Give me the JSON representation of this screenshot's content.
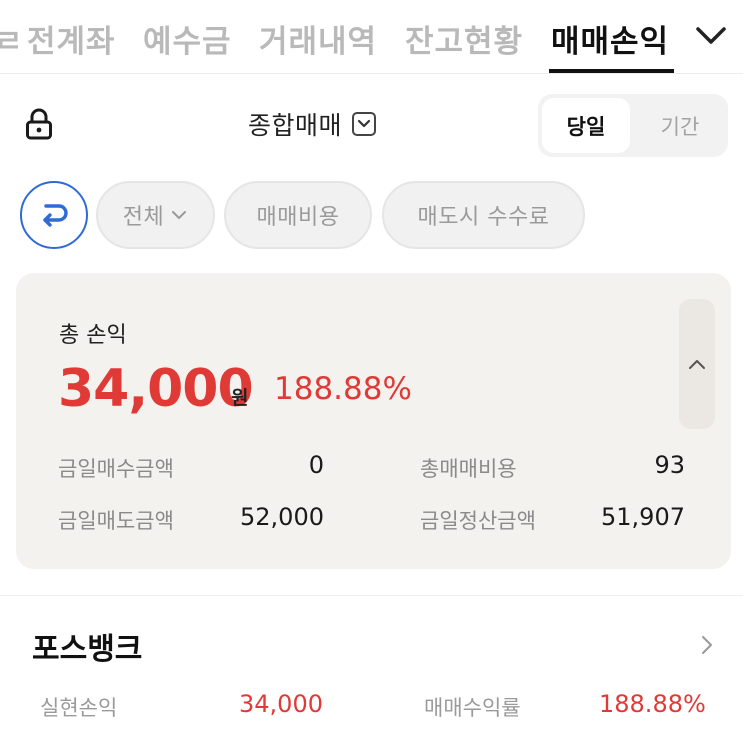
{
  "tabs": {
    "partial_left": "ㄹ",
    "items": [
      "전계좌",
      "예수금",
      "거래내역",
      "잔고현황",
      "매매손익"
    ],
    "active": "매매손익"
  },
  "toolbar": {
    "account_type": "종합매매",
    "period_options": [
      "당일",
      "기간"
    ],
    "period_selected": "당일"
  },
  "filters": {
    "chips": [
      "전체",
      "매매비용",
      "매도시 수수료"
    ]
  },
  "summary": {
    "title": "총 손익",
    "total_profit": "34,000",
    "currency": "원",
    "return_rate": "188.88%",
    "details": {
      "buy_today_label": "금일매수금액",
      "buy_today_value": "0",
      "total_cost_label": "총매매비용",
      "total_cost_value": "93",
      "sell_today_label": "금일매도금액",
      "sell_today_value": "52,000",
      "settlement_label": "금일정산금액",
      "settlement_value": "51,907"
    }
  },
  "bank": {
    "name": "포스뱅크",
    "realized_label": "실현손익",
    "realized_value": "34,000",
    "return_label": "매매수익률",
    "return_value": "188.88%"
  },
  "colors": {
    "profit_red": "#e03a36",
    "accent_blue": "#2f6ad6",
    "card_bg": "#f4f2ee"
  },
  "icons": [
    "lock-icon",
    "chevron-down-icon",
    "refresh-icon",
    "chevron-up-icon",
    "chevron-right-icon"
  ]
}
